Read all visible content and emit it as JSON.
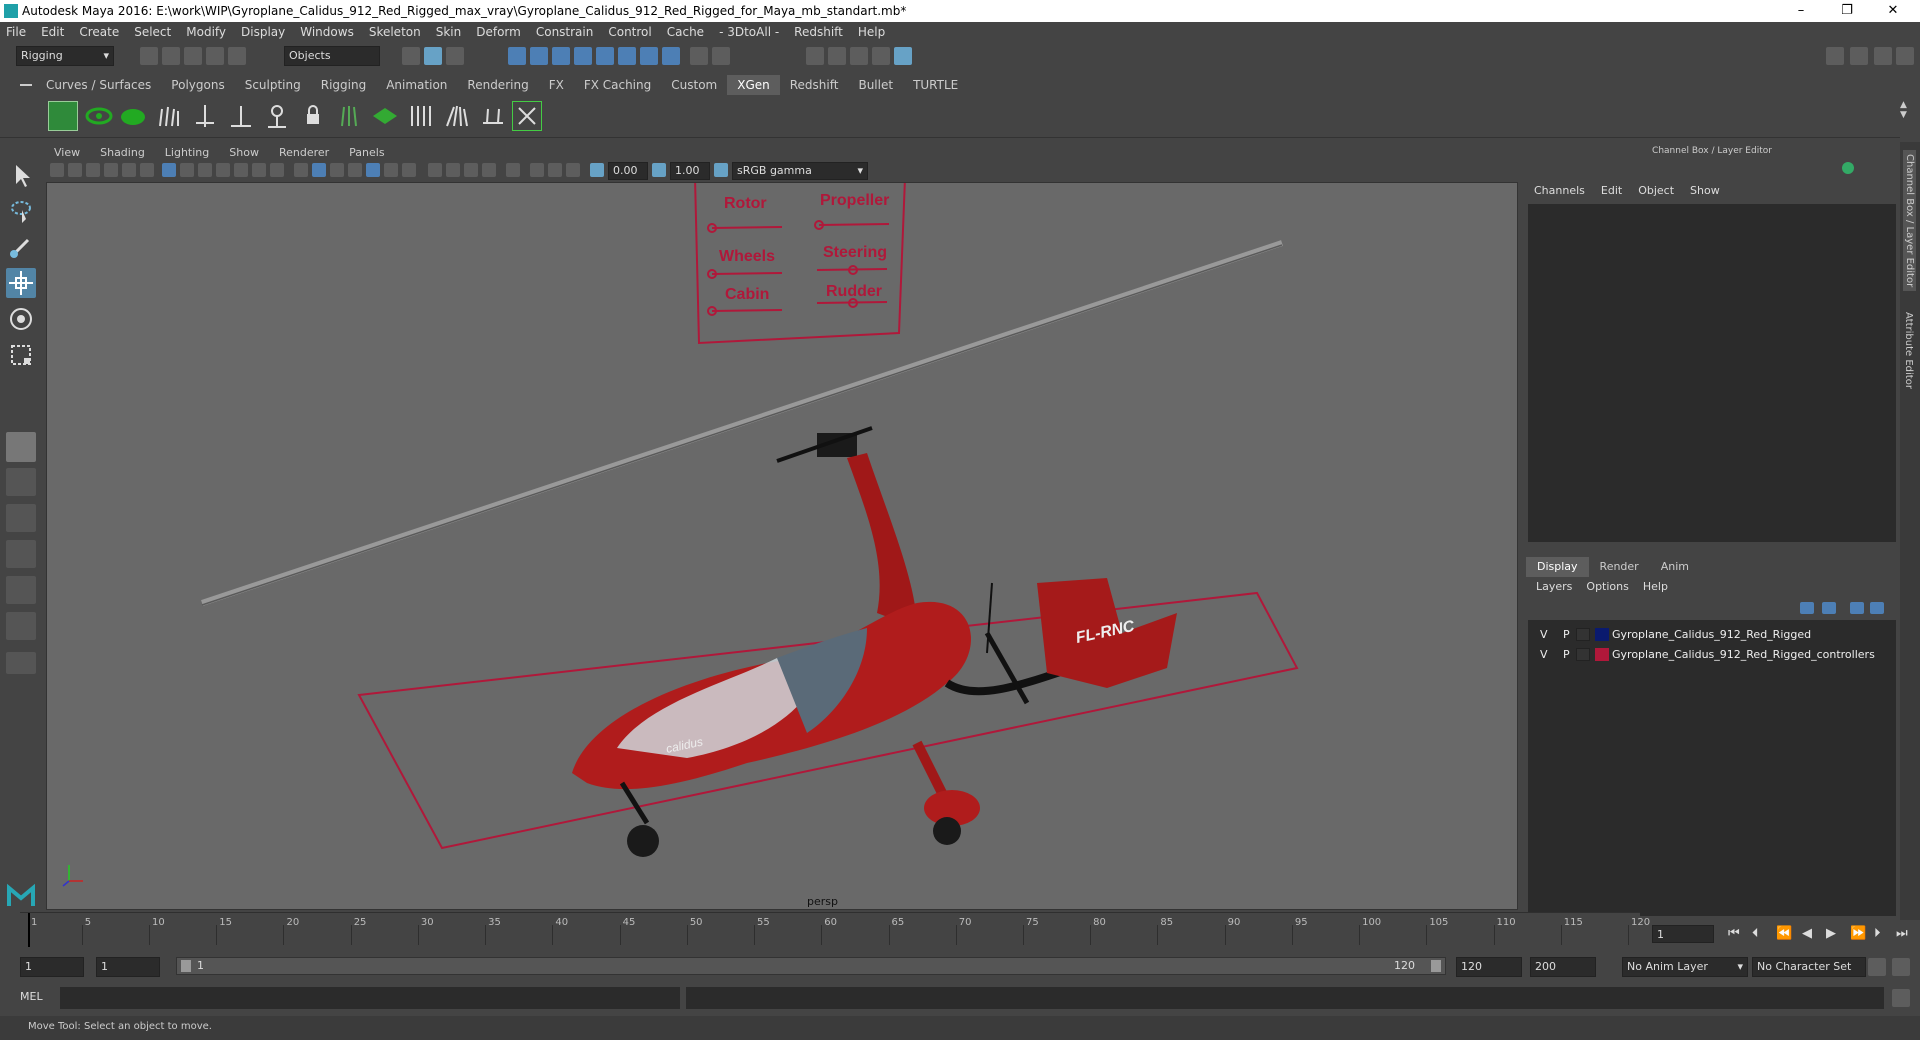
{
  "window": {
    "title": "Autodesk Maya 2016: E:\\work\\WIP\\Gyroplane_Calidus_912_Red_Rigged_max_vray\\Gyroplane_Calidus_912_Red_Rigged_for_Maya_mb_standart.mb*",
    "controls": [
      "–",
      "❐",
      "✕"
    ]
  },
  "menubar": [
    "File",
    "Edit",
    "Create",
    "Select",
    "Modify",
    "Display",
    "Windows",
    "Skeleton",
    "Skin",
    "Deform",
    "Constrain",
    "Control",
    "Cache",
    "- 3DtoAll -",
    "Redshift",
    "Help"
  ],
  "statusline": {
    "menuset": "Rigging",
    "select_mode": "Objects"
  },
  "shelf": {
    "tabs": [
      "Curves / Surfaces",
      "Polygons",
      "Sculpting",
      "Rigging",
      "Animation",
      "Rendering",
      "FX",
      "FX Caching",
      "Custom",
      "XGen",
      "Redshift",
      "Bullet",
      "TURTLE"
    ],
    "active_tab": "XGen"
  },
  "viewport": {
    "menu": [
      "View",
      "Shading",
      "Lighting",
      "Show",
      "Renderer",
      "Panels"
    ],
    "exposure": "0.00",
    "gamma": "1.00",
    "color_space": "sRGB gamma",
    "camera_label": "persp",
    "controller_panel": {
      "labels": [
        "Rotor",
        "Propeller",
        "Wheels",
        "Steering",
        "Cabin",
        "Rudder"
      ]
    },
    "tail_text": "FL-RNC",
    "brand_text": "calidus"
  },
  "channel_box": {
    "title": "Channel Box / Layer Editor",
    "menu": [
      "Channels",
      "Edit",
      "Object",
      "Show"
    ]
  },
  "layer_editor": {
    "tabs": [
      "Display",
      "Render",
      "Anim"
    ],
    "active_tab": "Display",
    "menu": [
      "Layers",
      "Options",
      "Help"
    ],
    "layers": [
      {
        "v": "V",
        "p": "P",
        "color": "#0a1a6e",
        "name": "Gyroplane_Calidus_912_Red_Rigged"
      },
      {
        "v": "V",
        "p": "P",
        "color": "#b0183a",
        "name": "Gyroplane_Calidus_912_Red_Rigged_controllers"
      }
    ]
  },
  "side_tabs": [
    "Channel Box / Layer Editor",
    "Attribute Editor"
  ],
  "timeline": {
    "ticks": [
      "1",
      "5",
      "10",
      "15",
      "20",
      "25",
      "30",
      "35",
      "40",
      "45",
      "50",
      "55",
      "60",
      "65",
      "70",
      "75",
      "80",
      "85",
      "90",
      "95",
      "100",
      "105",
      "110",
      "115",
      "120"
    ],
    "current_frame": "1"
  },
  "range": {
    "start": "1",
    "start_inner": "1",
    "slider_start": "1",
    "slider_end": "120",
    "end_inner": "120",
    "end": "200",
    "anim_layer": "No Anim Layer",
    "character_set": "No Character Set"
  },
  "command": {
    "lang": "MEL"
  },
  "help_line": "Move Tool: Select an object to move.",
  "colors": {
    "accent": "#5285a6",
    "rig_red": "#b0183a",
    "viewport_bg": "#696969"
  }
}
